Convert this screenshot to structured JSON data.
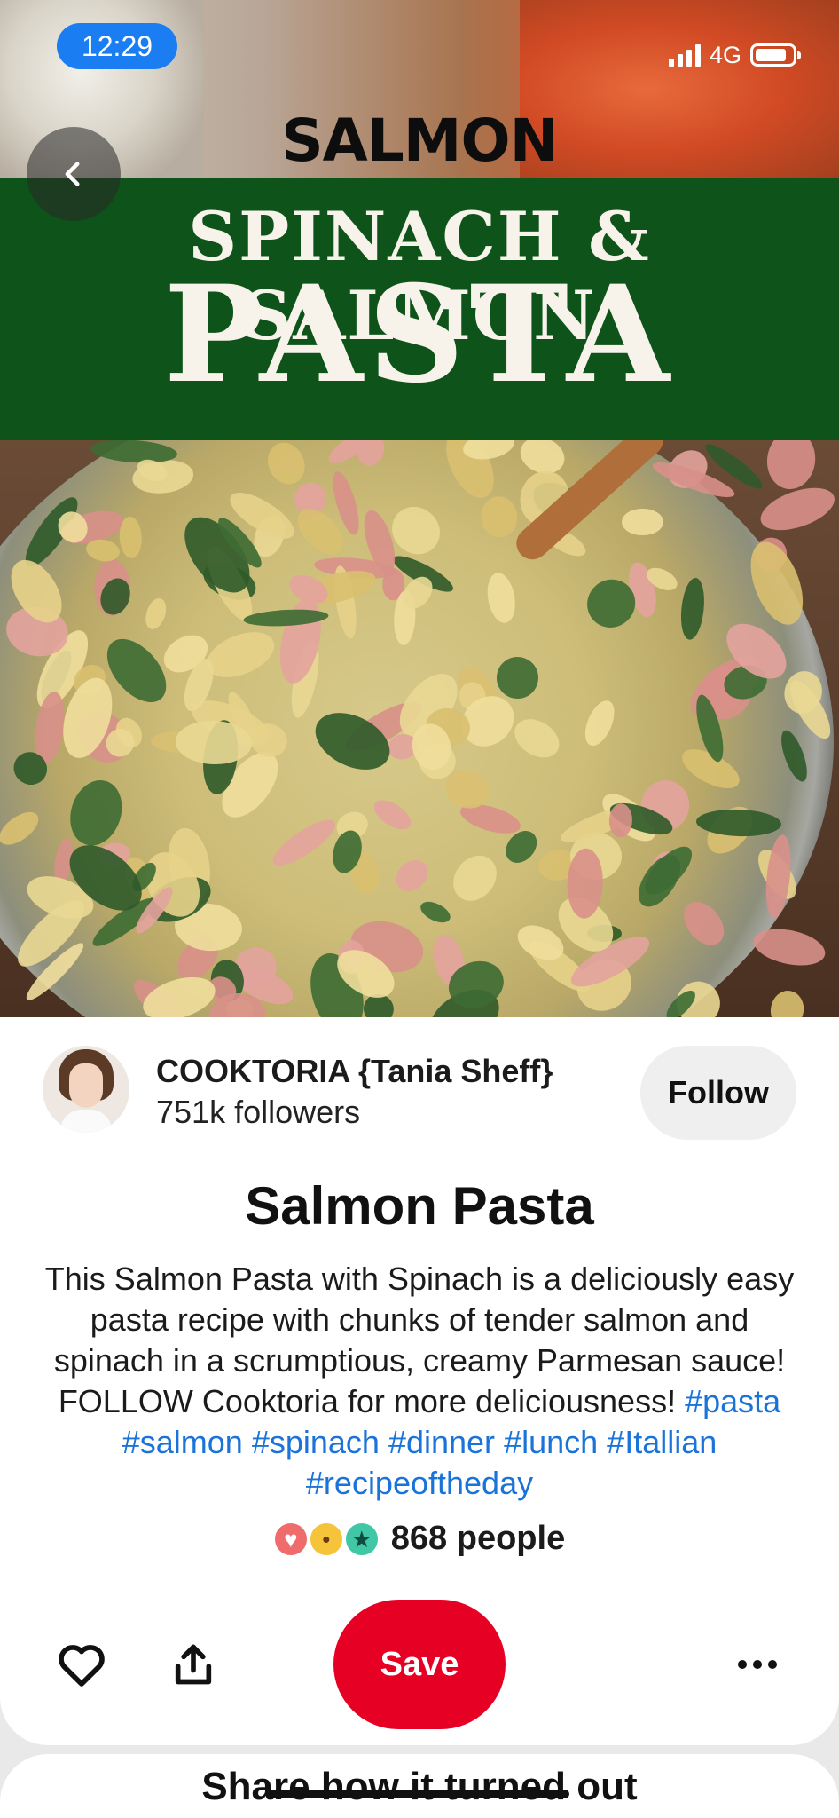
{
  "status_bar": {
    "time": "12:29",
    "network": "4G"
  },
  "hero": {
    "subtitle": "SALMON",
    "banner_line1": "SPINACH & SALMON",
    "banner_line2": "PASTA",
    "banner_color": "#0e5319"
  },
  "creator": {
    "name": "COOKTORIA {Tania Sheff}",
    "followers": "751k followers",
    "follow_label": "Follow"
  },
  "pin": {
    "title": "Salmon Pasta",
    "description_plain": "This Salmon Pasta with Spinach is a deliciously easy pasta recipe with chunks of tender salmon and spinach in a scrumptious, creamy Parmesan sauce! FOLLOW Cooktoria for more deliciousness! ",
    "hashtags": [
      "#pasta",
      "#salmon",
      "#spinach",
      "#dinner",
      "#lunch",
      "#Itallian",
      "#recipeoftheday"
    ],
    "reactions_count": "868 people"
  },
  "actions": {
    "save_label": "Save",
    "save_color": "#e60023"
  },
  "next_section": {
    "title": "Share how it turned out"
  },
  "icons": [
    "chevron-left-icon",
    "signal-icon",
    "battery-icon",
    "heart-outline-icon",
    "share-icon",
    "more-icon"
  ]
}
